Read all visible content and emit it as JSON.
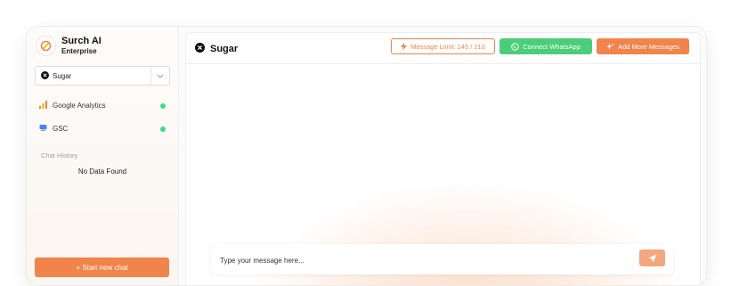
{
  "brand": {
    "name": "Surch AI",
    "subtitle": "Enterprise"
  },
  "site_select": {
    "value": "Sugar"
  },
  "sources": [
    {
      "name": "Google Analytics",
      "status": "connected"
    },
    {
      "name": "GSC",
      "status": "connected"
    }
  ],
  "history": {
    "label": "Chat History",
    "empty": "No Data Found"
  },
  "sidebar_action": {
    "label": "+ Start new chat"
  },
  "header": {
    "title": "Sugar",
    "limit": "Message Limit: 145 / 210",
    "whatsapp": "Connect WhatsApp",
    "more": "Add More Messages"
  },
  "composer": {
    "placeholder": "Type your message here..."
  },
  "colors": {
    "accent": "#f0844a",
    "whatsapp": "#4ccd7a",
    "status_ok": "#3ddc84"
  }
}
